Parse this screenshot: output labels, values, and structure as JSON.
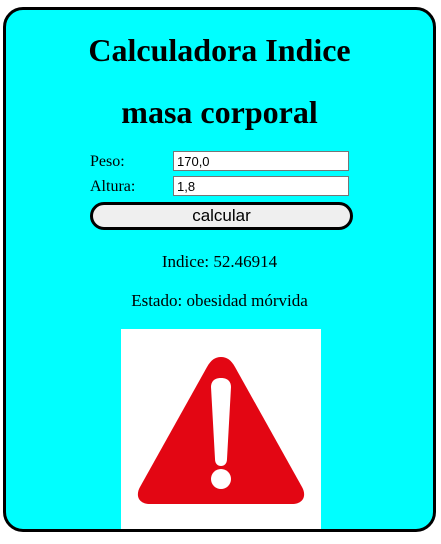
{
  "header": {
    "title_line1": "Calculadora Indice",
    "title_line2": "masa corporal"
  },
  "form": {
    "peso_label": "Peso:",
    "peso_value": "170,0",
    "altura_label": "Altura:",
    "altura_value": "1,8",
    "calc_button": "calcular"
  },
  "result": {
    "indice_text": "Indice: 52.46914",
    "estado_text": "Estado: obesidad mórvida"
  },
  "warning": {
    "icon": "warning-triangle-icon",
    "color": "#e30613"
  },
  "colors": {
    "background": "#00ffff",
    "border": "#000000"
  }
}
